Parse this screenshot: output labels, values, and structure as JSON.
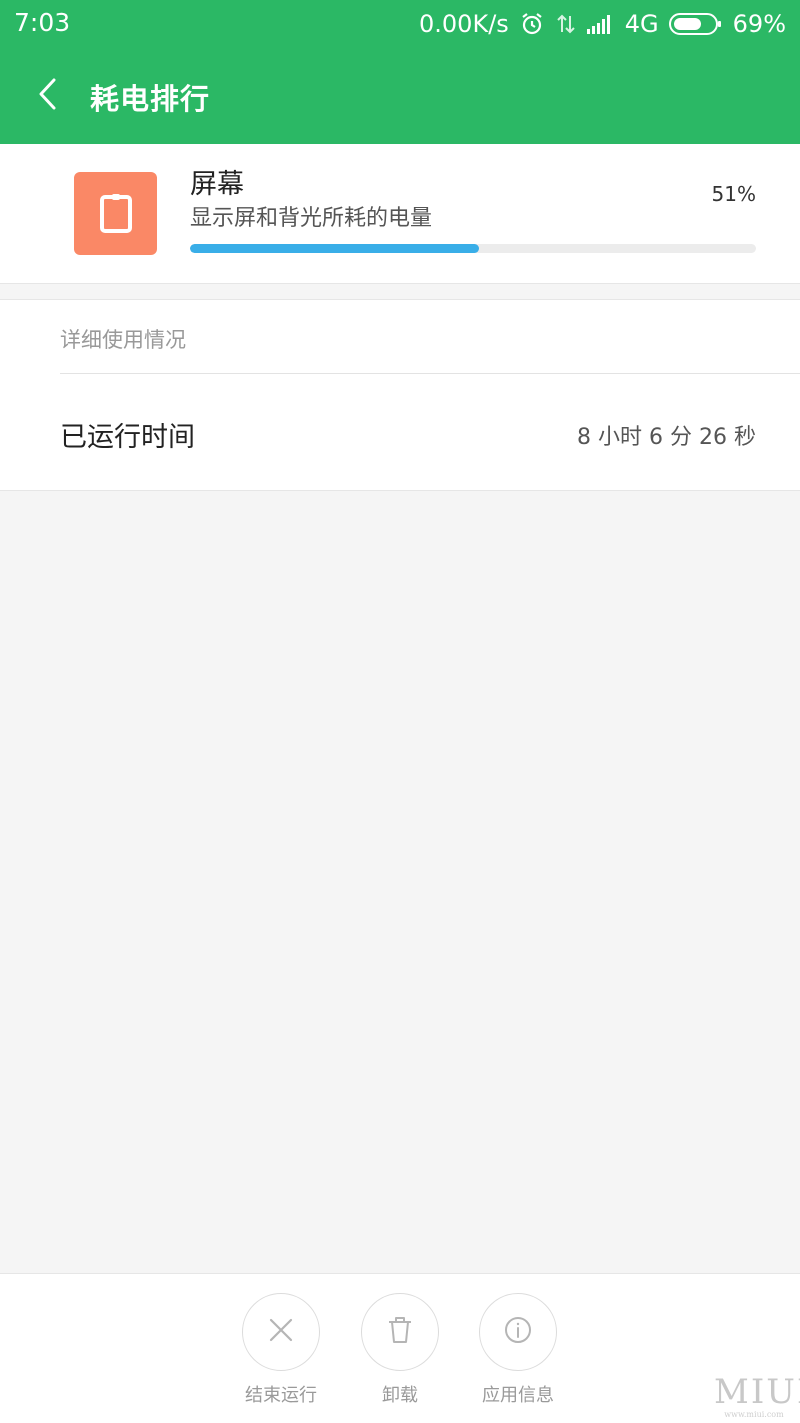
{
  "status_bar": {
    "time": "7:03",
    "net_speed": "0.00K/s",
    "network": "4G",
    "battery_percent": "69%",
    "battery_level": 0.69,
    "icons": [
      "alarm-icon",
      "data-transfer-icon",
      "signal-icon",
      "battery-icon"
    ]
  },
  "app_bar": {
    "back_icon": "chevron-left-icon",
    "title": "耗电排行"
  },
  "item": {
    "icon": "screen-icon",
    "icon_color": "#fa8866",
    "title": "屏幕",
    "description": "显示屏和背光所耗的电量",
    "percent_label": "51%",
    "progress": 0.51,
    "progress_color": "#39aee8"
  },
  "details": {
    "section_title": "详细使用情况",
    "runtime_label": "已运行时间",
    "runtime_value": "8 小时 6 分 26 秒"
  },
  "actions": [
    {
      "label": "结束运行",
      "icon": "close-icon"
    },
    {
      "label": "卸载",
      "icon": "trash-icon"
    },
    {
      "label": "应用信息",
      "icon": "info-icon"
    }
  ],
  "watermark": {
    "text": "MIUI",
    "url": "www.miui.com"
  },
  "colors": {
    "accent": "#2bb865",
    "background": "#f5f5f5"
  }
}
